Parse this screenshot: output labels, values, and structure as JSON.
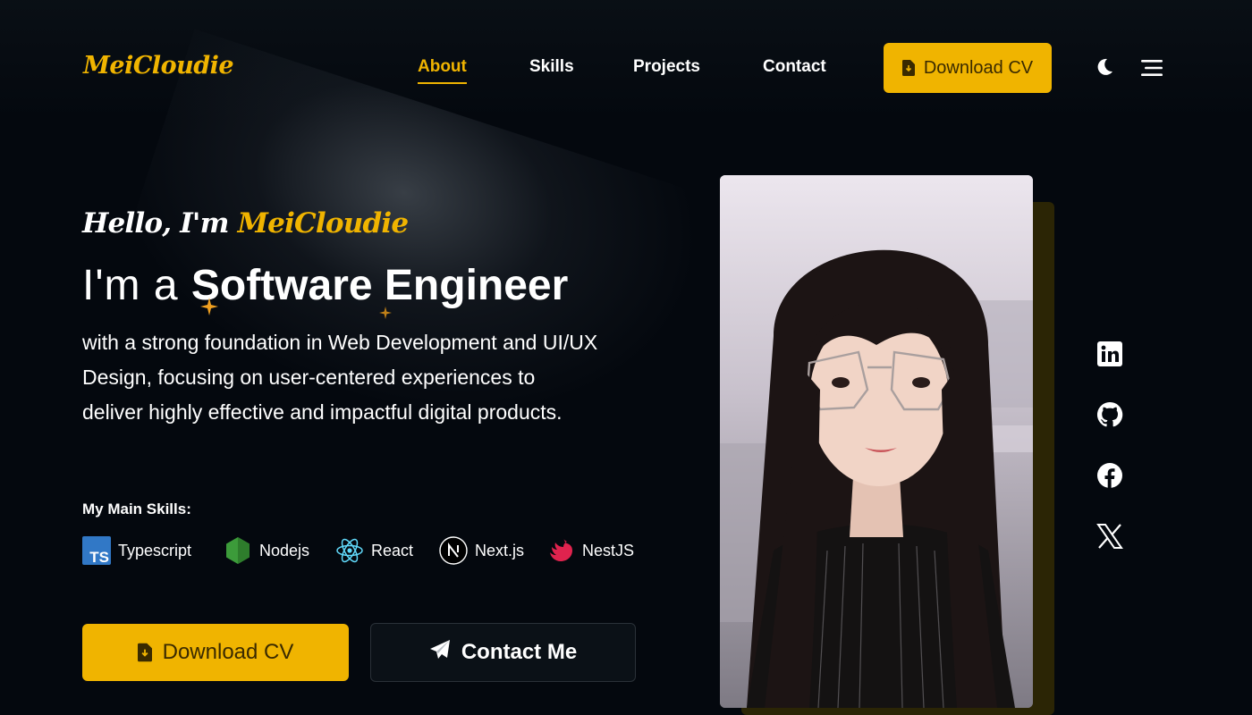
{
  "header": {
    "logo": "MeiCloudie",
    "nav": [
      {
        "label": "About",
        "active": true
      },
      {
        "label": "Skills",
        "active": false
      },
      {
        "label": "Projects",
        "active": false
      },
      {
        "label": "Contact",
        "active": false
      }
    ],
    "download_cv_label": "Download CV",
    "theme_icon": "moon-icon",
    "menu_icon": "hamburger-menu-icon"
  },
  "hero": {
    "greeting_prefix": "Hello, I'm ",
    "greeting_name": "MeiCloudie",
    "headline_prefix": "I'm a ",
    "headline_role": "Software Engineer",
    "description": "with a strong foundation in Web Development and UI/UX Design, focusing on user-centered experiences to deliver highly effective and impactful digital products.",
    "skills_title": "My Main Skills:",
    "skills": [
      {
        "name": "Typescript",
        "icon": "typescript-icon"
      },
      {
        "name": "Nodejs",
        "icon": "nodejs-icon"
      },
      {
        "name": "React",
        "icon": "react-icon"
      },
      {
        "name": "Next.js",
        "icon": "nextjs-icon"
      },
      {
        "name": "NestJS",
        "icon": "nestjs-icon"
      }
    ],
    "download_cv_label": "Download CV",
    "contact_label": "Contact Me"
  },
  "social": [
    "linkedin-icon",
    "github-icon",
    "facebook-icon",
    "x-icon"
  ],
  "colors": {
    "accent": "#f0b400",
    "background": "#04080e",
    "text": "#ffffff"
  }
}
